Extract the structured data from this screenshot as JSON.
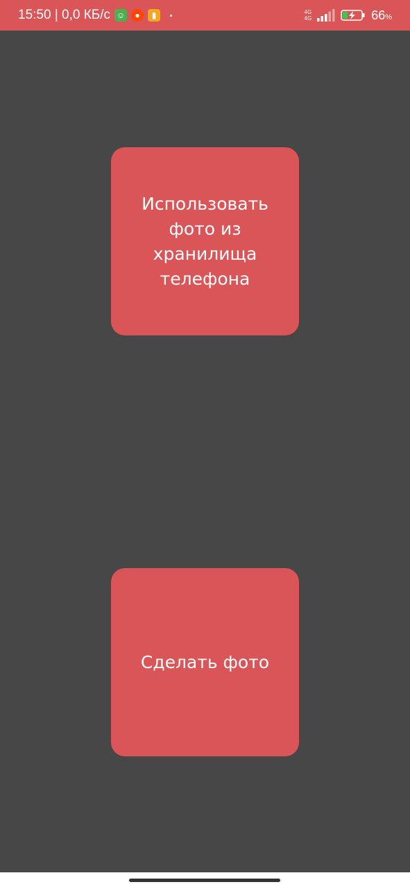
{
  "status_bar": {
    "time_and_speed": "15:50 | 0,0 КБ/с",
    "network_top": "4G",
    "network_bottom": "4G",
    "battery_percent": "66",
    "battery_unit": "%",
    "notification_icons": [
      "messenger-app-icon",
      "reddit-icon",
      "notes-app-icon"
    ],
    "colors": {
      "bar": "#d95557"
    }
  },
  "main": {
    "background": "#474747",
    "buttons": [
      {
        "label": "Использовать фото из хранилища телефона"
      },
      {
        "label": "Сделать фото"
      }
    ],
    "button_color": "#d95557"
  }
}
